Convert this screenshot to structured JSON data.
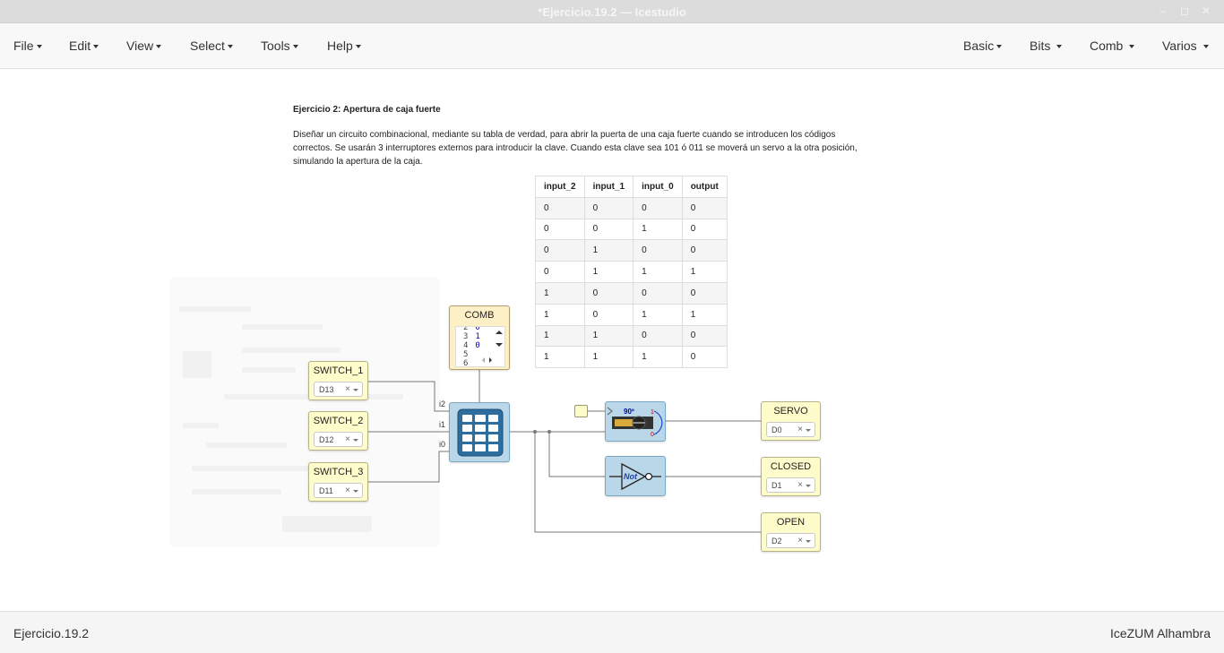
{
  "window": {
    "title": "*Ejercicio.19.2 — Icestudio"
  },
  "menu_left": [
    {
      "label": "File"
    },
    {
      "label": "Edit"
    },
    {
      "label": "View"
    },
    {
      "label": "Select"
    },
    {
      "label": "Tools"
    },
    {
      "label": "Help"
    }
  ],
  "menu_right": [
    {
      "label": "Basic"
    },
    {
      "label": "Bits"
    },
    {
      "label": "Comb"
    },
    {
      "label": "Varios"
    }
  ],
  "doc": {
    "title": "Ejercicio 2: Apertura de caja fuerte",
    "body": "Diseñar un circuito combinacional, mediante su tabla de verdad, para abrir la puerta de una caja fuerte cuando se introducen los códigos correctos. Se usarán 3 interruptores externos para introducir la clave. Cuando esta clave sea 101 ó 011 se moverá un servo a la otra posición, simulando la apertura de la caja."
  },
  "truth_table": {
    "headers": [
      "input_2",
      "input_1",
      "input_0",
      "output"
    ],
    "rows": [
      [
        "0",
        "0",
        "0",
        "0"
      ],
      [
        "0",
        "0",
        "1",
        "0"
      ],
      [
        "0",
        "1",
        "0",
        "0"
      ],
      [
        "0",
        "1",
        "1",
        "1"
      ],
      [
        "1",
        "0",
        "0",
        "0"
      ],
      [
        "1",
        "0",
        "1",
        "1"
      ],
      [
        "1",
        "1",
        "0",
        "0"
      ],
      [
        "1",
        "1",
        "1",
        "0"
      ]
    ]
  },
  "inputs": [
    {
      "label": "SWITCH_1",
      "pin": "D13",
      "clear": "×"
    },
    {
      "label": "SWITCH_2",
      "pin": "D12",
      "clear": "×"
    },
    {
      "label": "SWITCH_3",
      "pin": "D11",
      "clear": "×"
    }
  ],
  "outputs": [
    {
      "label": "SERVO",
      "pin": "D0",
      "clear": "×"
    },
    {
      "label": "CLOSED",
      "pin": "D1",
      "clear": "×"
    },
    {
      "label": "OPEN",
      "pin": "D2",
      "clear": "×"
    }
  ],
  "comb_block": {
    "label": "COMB",
    "code_lines": [
      {
        "n": "2",
        "v": "0"
      },
      {
        "n": "3",
        "v": "1"
      },
      {
        "n": "4",
        "v": "0"
      },
      {
        "n": "5",
        "v": "1"
      },
      {
        "n": "6",
        "v": ""
      }
    ]
  },
  "ports": {
    "i2": "i2",
    "i1": "i1",
    "i0": "i0"
  },
  "servo_icon": {
    "angle": "90º",
    "one": "1",
    "zero": "0"
  },
  "not_gate": {
    "label": "Not"
  },
  "status": {
    "file": "Ejercicio.19.2",
    "board": "IceZUM Alhambra"
  },
  "colors": {
    "input_block": "#fffccc",
    "comb_block": "#fdf0c6",
    "code_block": "#b9d7e8",
    "wire": "#777777"
  }
}
